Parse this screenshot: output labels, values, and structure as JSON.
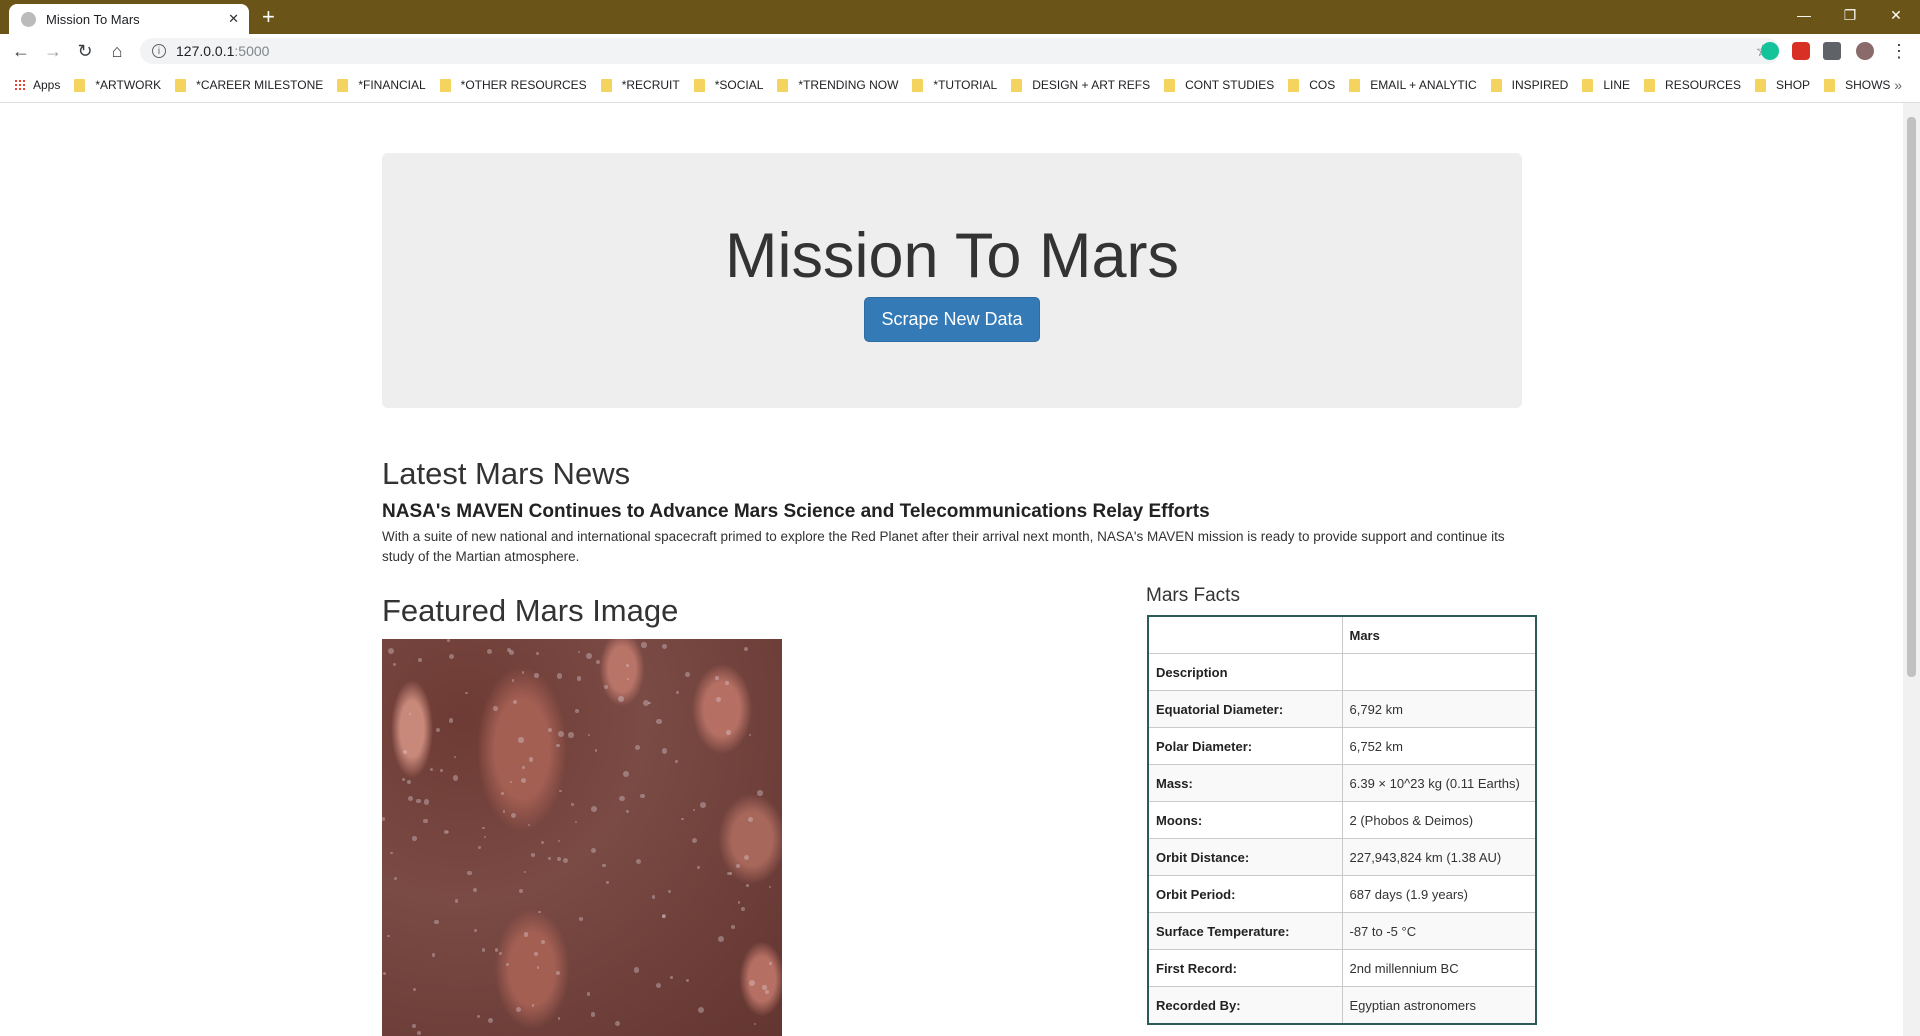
{
  "browser": {
    "tab_title": "Mission To Mars",
    "url_host": "127.0.0.1",
    "url_port": ":5000",
    "bookmarks": [
      "Apps",
      "*ARTWORK",
      "*CAREER MILESTONE",
      "*FINANCIAL",
      "*OTHER RESOURCES",
      "*RECRUIT",
      "*SOCIAL",
      "*TRENDING NOW",
      "*TUTORIAL",
      "DESIGN + ART REFS",
      "CONT STUDIES",
      "COS",
      "EMAIL + ANALYTIC",
      "INSPIRED",
      "LINE",
      "RESOURCES",
      "SHOP",
      "SHOWS"
    ]
  },
  "jumbotron": {
    "title": "Mission To Mars",
    "button_label": "Scrape New Data"
  },
  "news": {
    "section_title": "Latest Mars News",
    "headline": "NASA's MAVEN Continues to Advance Mars Science and Telecommunications Relay Efforts",
    "body": "With a suite of new national and international spacecraft primed to explore the Red Planet after their arrival next month, NASA's MAVEN mission is ready to provide support and continue its study of the Martian atmosphere."
  },
  "featured_image": {
    "section_title": "Featured Mars Image"
  },
  "facts": {
    "section_title": "Mars Facts",
    "header": [
      "",
      "Mars"
    ],
    "rows": [
      [
        "Description",
        ""
      ],
      [
        "Equatorial Diameter:",
        "6,792 km"
      ],
      [
        "Polar Diameter:",
        "6,752 km"
      ],
      [
        "Mass:",
        "6.39 × 10^23 kg (0.11 Earths)"
      ],
      [
        "Moons:",
        "2 (Phobos & Deimos)"
      ],
      [
        "Orbit Distance:",
        "227,943,824 km (1.38 AU)"
      ],
      [
        "Orbit Period:",
        "687 days (1.9 years)"
      ],
      [
        "Surface Temperature:",
        "-87 to -5 °C"
      ],
      [
        "First Record:",
        "2nd millennium BC"
      ],
      [
        "Recorded By:",
        "Egyptian astronomers"
      ]
    ]
  }
}
